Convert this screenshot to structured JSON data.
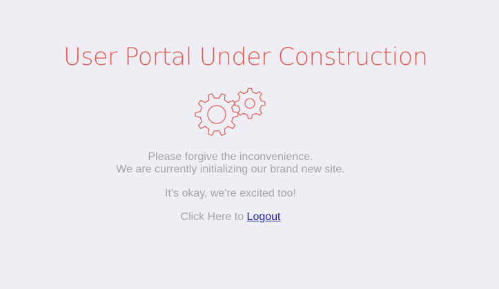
{
  "page": {
    "title": "User Portal Under Construction",
    "messages": {
      "line1": "Please forgive the inconvenience.",
      "line2": "We are currently initializing our brand new site.",
      "line3": "It's okay, we're excited too!"
    },
    "logout": {
      "prefix": "Click Here to",
      "link_label": "Logout"
    },
    "icon": "gears-icon"
  },
  "colors": {
    "background": "#efeef5",
    "accent": "#e4594f",
    "text": "#a4a4a8",
    "link": "#1f1fb0"
  }
}
